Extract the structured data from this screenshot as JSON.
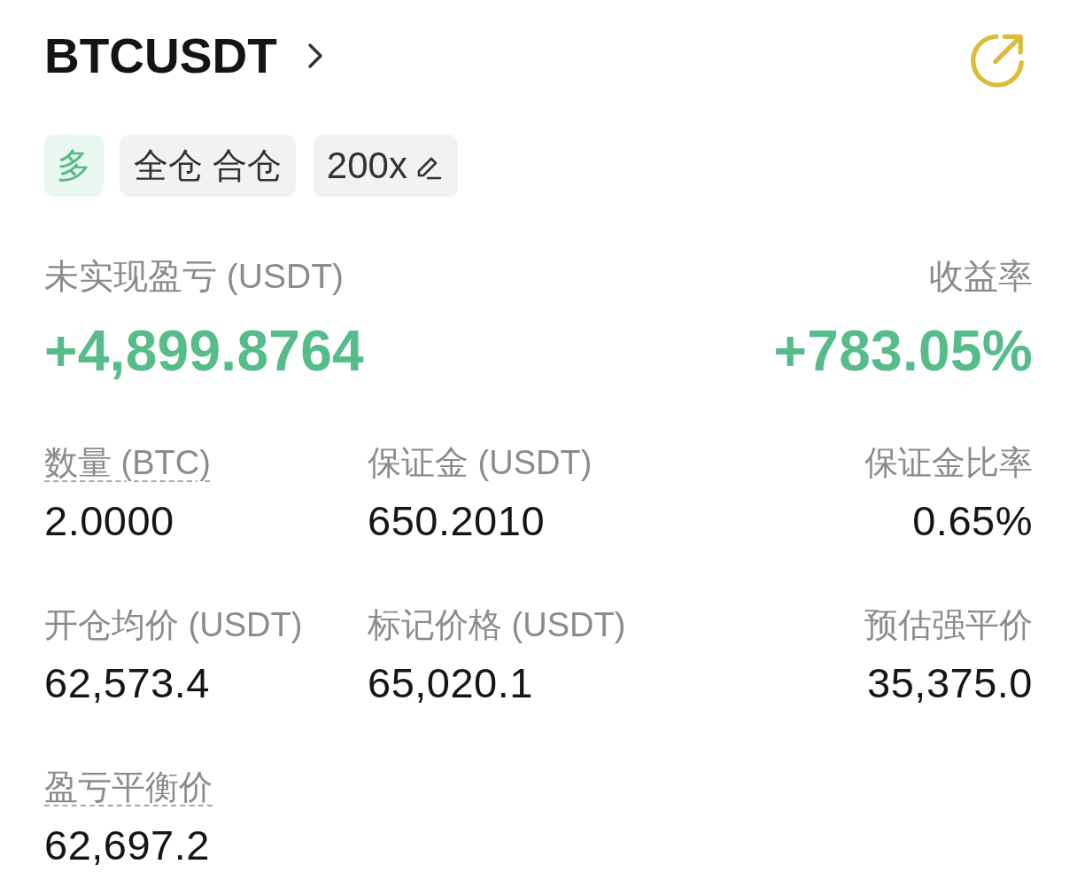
{
  "header": {
    "symbol": "BTCUSDT"
  },
  "tags": [
    {
      "kind": "side",
      "label": "多"
    },
    {
      "kind": "mode",
      "label": "全仓 合仓"
    },
    {
      "kind": "leverage",
      "label": "200x"
    }
  ],
  "summary": [
    {
      "label": "未实现盈亏 (USDT)",
      "value": "+4,899.8764",
      "profit": true
    },
    {
      "label": "收益率",
      "value": "+783.05%",
      "profit": true
    }
  ],
  "fields": [
    {
      "label": "数量 (BTC)",
      "value": "2.0000",
      "tooltip": true
    },
    {
      "label": "保证金 (USDT)",
      "value": "650.2010",
      "tooltip": false
    },
    {
      "label": "保证金比率",
      "value": "0.65%",
      "tooltip": false
    },
    {
      "label": "开仓均价 (USDT)",
      "value": "62,573.4",
      "tooltip": false
    },
    {
      "label": "标记价格 (USDT)",
      "value": "65,020.1",
      "tooltip": false
    },
    {
      "label": "预估强平价",
      "value": "35,375.0",
      "tooltip": false
    },
    {
      "label": "盈亏平衡价",
      "value": "62,697.2",
      "tooltip": true
    }
  ]
}
